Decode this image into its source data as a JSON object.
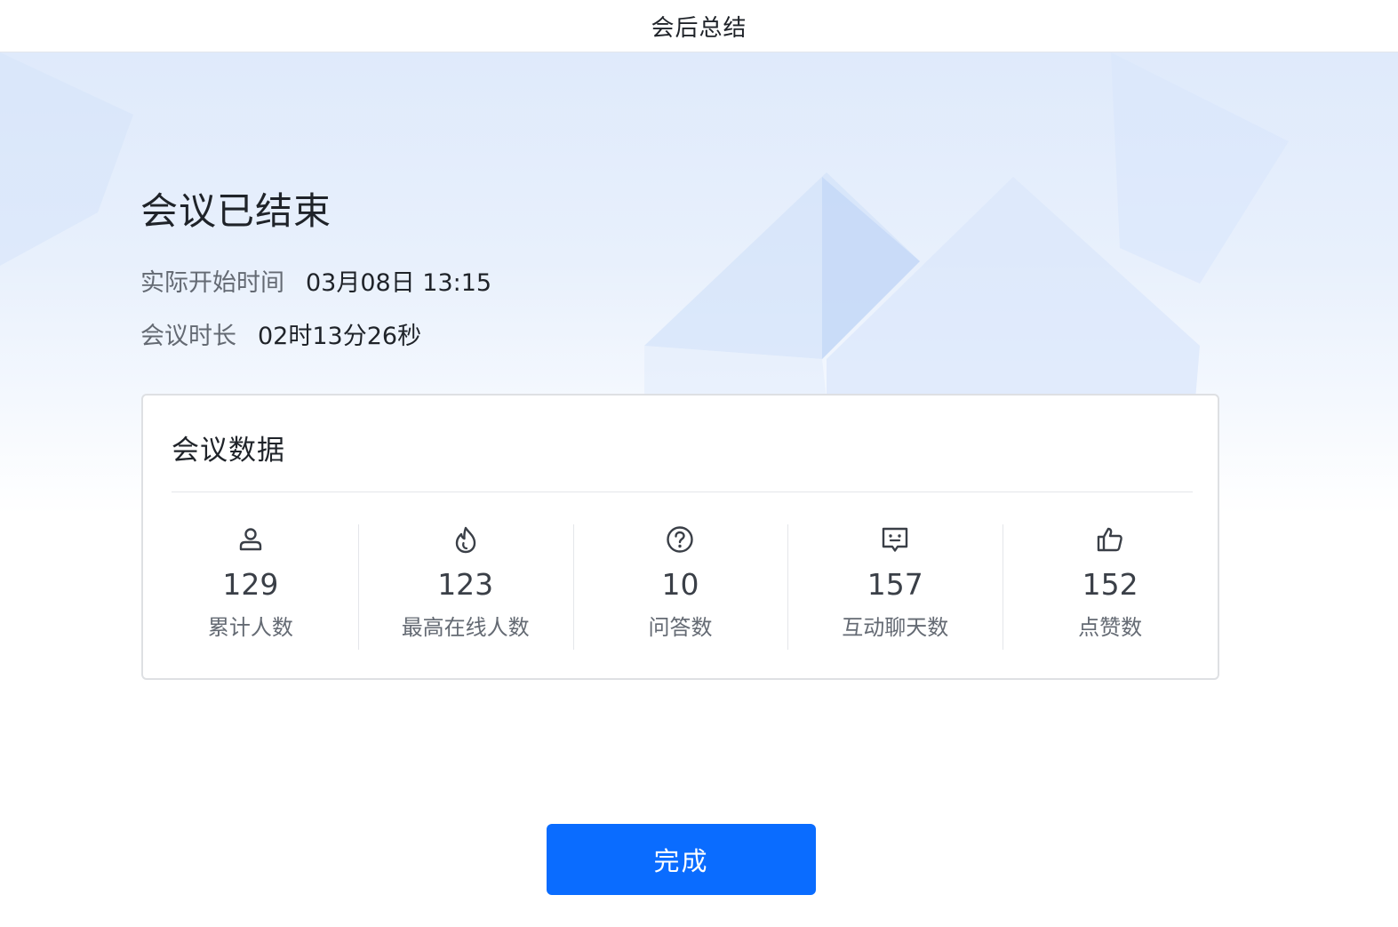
{
  "window": {
    "title": "会后总结"
  },
  "meeting": {
    "status_title": "会议已结束",
    "start_label": "实际开始时间",
    "start_value": "03月08日 13:15",
    "duration_label": "会议时长",
    "duration_value": "02时13分26秒"
  },
  "data_card": {
    "title": "会议数据",
    "stats": [
      {
        "icon": "person-icon",
        "value": "129",
        "label": "累计人数"
      },
      {
        "icon": "flame-icon",
        "value": "123",
        "label": "最高在线人数"
      },
      {
        "icon": "question-icon",
        "value": "10",
        "label": "问答数"
      },
      {
        "icon": "chat-icon",
        "value": "157",
        "label": "互动聊天数"
      },
      {
        "icon": "thumbs-up-icon",
        "value": "152",
        "label": "点赞数"
      }
    ]
  },
  "actions": {
    "done_label": "完成"
  },
  "colors": {
    "accent": "#0a6cff",
    "icon": "#3a3f47",
    "muted_text": "#646a73"
  }
}
